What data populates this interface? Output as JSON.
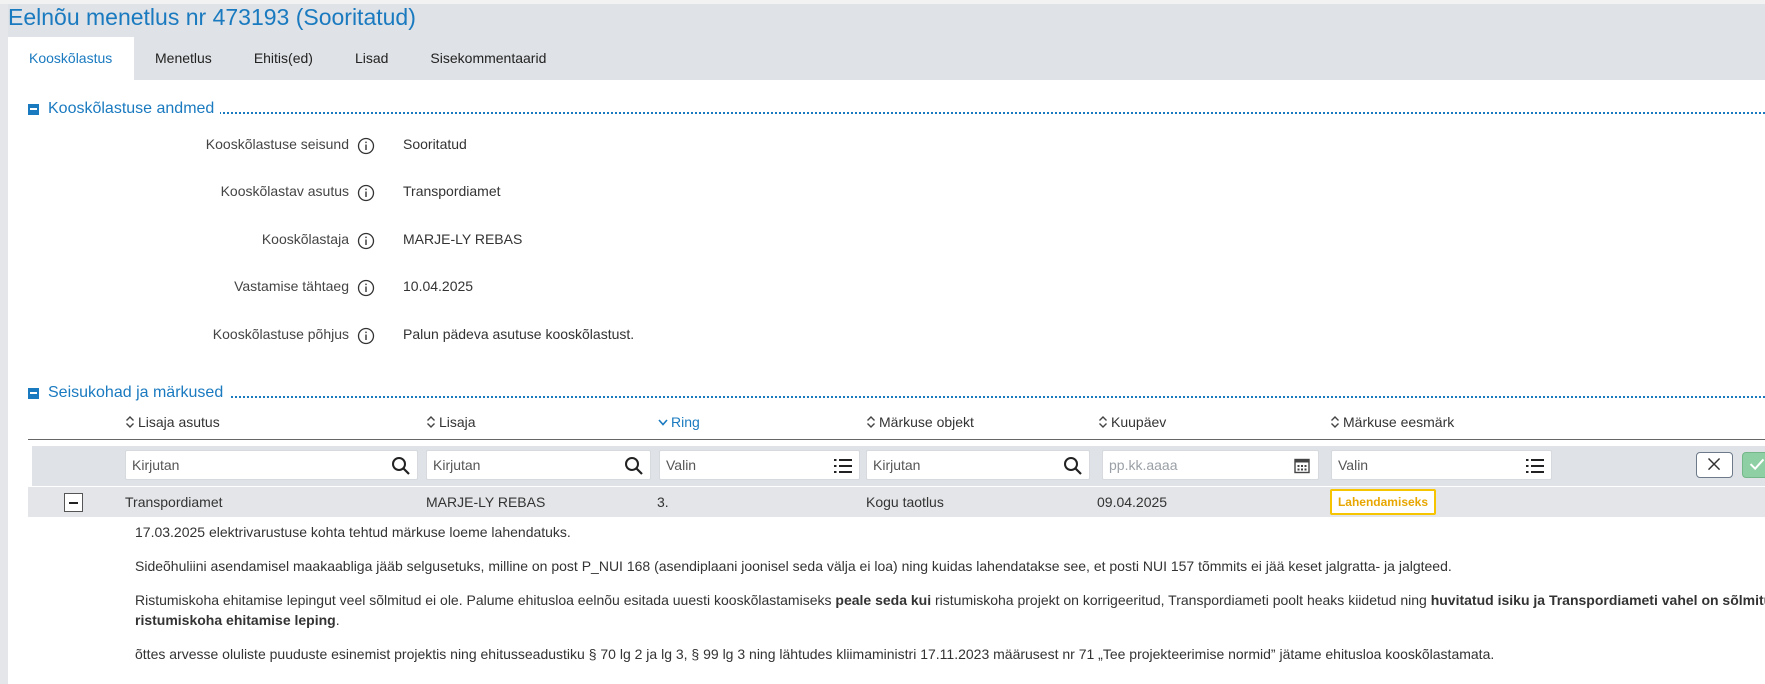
{
  "page": {
    "title": "Eelnõu menetlus nr 473193 (Sooritatud)"
  },
  "tabs": [
    {
      "label": "Kooskõlastus",
      "active": true
    },
    {
      "label": "Menetlus"
    },
    {
      "label": "Ehitis(ed)"
    },
    {
      "label": "Lisad"
    },
    {
      "label": "Sisekommentaarid"
    }
  ],
  "approval_section": {
    "title": "Kooskõlastuse andmed",
    "fields": [
      {
        "label": "Kooskõlastuse seisund",
        "value": "Sooritatud"
      },
      {
        "label": "Kooskõlastav asutus",
        "value": "Transpordiamet"
      },
      {
        "label": "Kooskõlastaja",
        "value": "MARJE-LY REBAS"
      },
      {
        "label": "Vastamise tähtaeg",
        "value": "10.04.2025"
      },
      {
        "label": "Kooskõlastuse põhjus",
        "value": "Palun pädeva asutuse kooskõlastust."
      }
    ]
  },
  "remarks_section": {
    "title": "Seisukohad ja märkused",
    "columns": [
      {
        "label": "Lisaja asutus",
        "sort": "none"
      },
      {
        "label": "Lisaja",
        "sort": "none"
      },
      {
        "label": "Ring",
        "sort": "desc"
      },
      {
        "label": "Märkuse objekt",
        "sort": "none"
      },
      {
        "label": "Kuupäev",
        "sort": "none"
      },
      {
        "label": "Märkuse eesmärk",
        "sort": "none"
      }
    ],
    "filters": [
      {
        "placeholder": "Kirjutan",
        "icon": "search-icon"
      },
      {
        "placeholder": "Kirjutan",
        "icon": "search-icon"
      },
      {
        "placeholder": "Valin",
        "icon": "list-icon"
      },
      {
        "placeholder": "Kirjutan",
        "icon": "search-icon"
      },
      {
        "placeholder": "pp.kk.aaaa",
        "icon": "calendar-icon"
      },
      {
        "placeholder": "Valin",
        "icon": "list-icon"
      }
    ],
    "row": {
      "organization": "Transpordiamet",
      "author": "MARJE-LY REBAS",
      "round": "3.",
      "object": "Kogu taotlus",
      "date": "09.04.2025",
      "purpose": "Lahendamiseks"
    },
    "comment": {
      "p1": "17.03.2025 elektrivarustuse kohta tehtud märkuse loeme lahendatuks.",
      "p2": "Sideõhuliini asendamisel maakaabliga jääb selgusetuks, milline on post P_NUI 168 (asendiplaani joonisel seda välja ei loa) ning kuidas lahendatakse see, et posti NUI 157 tõmmits ei jää keset jalgratta- ja jalgteed.",
      "p3_a": "Ristumiskoha ehitamise lepingut veel sõlmitud ei ole. Palume ehitusloa eelnõu esitada uuesti kooskõlastamiseks ",
      "p3_b": "peale seda kui",
      "p3_c": " ristumiskoha projekt on korrigeeritud, Transpordiameti poolt heaks kiidetud ning ",
      "p3_d": "huvitatud isiku ja Transpordiameti vahel on sõlmitud",
      "p3_e": "ristumiskoha ehitamise leping",
      "p3_f": ".",
      "p4": "õttes arvesse oluliste puuduste esinemist projektis ning ehitusseadustiku § 70 lg 2 ja lg 3, § 99 lg 3 ning lähtudes kliimaministri 17.11.2023 määrusest nr 71 „Tee projekteerimise normid” jätame ehitusloa kooskõlastamata."
    }
  },
  "colors": {
    "accent": "#1a7ac0",
    "header_bg": "#dfe2e6",
    "badge_border": "#f6c400",
    "badge_text": "#e8a600",
    "confirm": "#8ed0a3"
  }
}
